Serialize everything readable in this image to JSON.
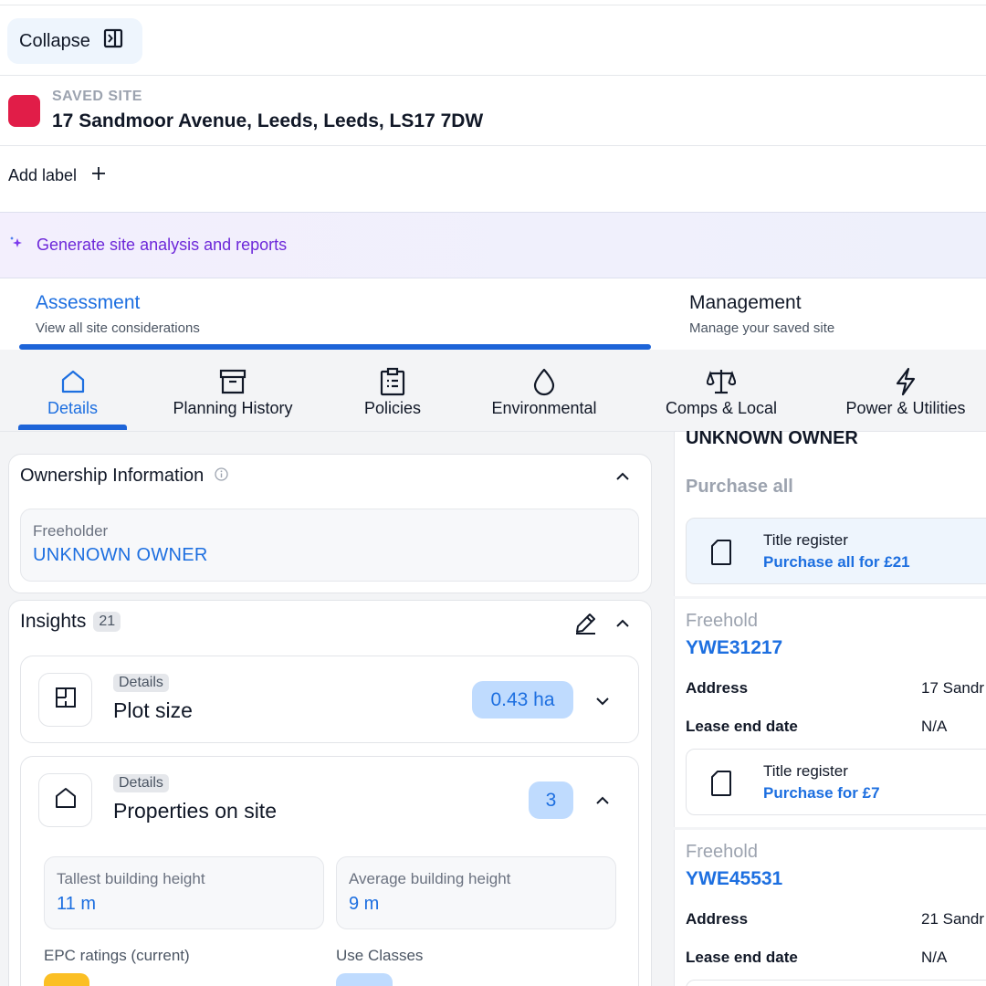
{
  "header": {
    "collapse_label": "Collapse"
  },
  "site": {
    "kicker": "SAVED SITE",
    "address": "17 Sandmoor Avenue, Leeds, Leeds, LS17 7DW",
    "color": "#e11d48"
  },
  "labels": {
    "add_label": "Add label"
  },
  "banner": {
    "text": "Generate site analysis and reports"
  },
  "tabs": [
    {
      "title": "Assessment",
      "subtitle": "View all site considerations",
      "active": true
    },
    {
      "title": "Management",
      "subtitle": "Manage your saved site",
      "active": false
    }
  ],
  "categories": [
    {
      "label": "Details",
      "icon": "home-icon",
      "active": true
    },
    {
      "label": "Planning History",
      "icon": "archive-icon",
      "active": false
    },
    {
      "label": "Policies",
      "icon": "clipboard-icon",
      "active": false
    },
    {
      "label": "Environmental",
      "icon": "droplet-icon",
      "active": false
    },
    {
      "label": "Comps & Local",
      "icon": "scale-icon",
      "active": false
    },
    {
      "label": "Power & Utilities",
      "icon": "bolt-icon",
      "active": false
    }
  ],
  "ownership": {
    "title": "Ownership Information",
    "freeholder_label": "Freeholder",
    "freeholder_value": "UNKNOWN OWNER"
  },
  "insights": {
    "title": "Insights",
    "count": "21",
    "items": [
      {
        "tag": "Details",
        "title": "Plot size",
        "value": "0.43 ha"
      },
      {
        "tag": "Details",
        "title": "Properties on site",
        "value": "3"
      }
    ],
    "metrics": [
      {
        "label": "Tallest building height",
        "value": "11 m"
      },
      {
        "label": "Average building height",
        "value": "9 m"
      }
    ],
    "sub_labels": [
      "EPC ratings (current)",
      "Use Classes"
    ]
  },
  "right": {
    "owner": "UNKNOWN OWNER",
    "purchase_all": "Purchase all",
    "title_register_label": "Title register",
    "purchase_all_price": "Purchase all for £21",
    "titles": [
      {
        "tenure": "Freehold",
        "number": "YWE31217",
        "address_label": "Address",
        "address_value": "17 Sandr",
        "lease_label": "Lease end date",
        "lease_value": "N/A",
        "reg_label": "Title register",
        "reg_price": "Purchase for £7"
      },
      {
        "tenure": "Freehold",
        "number": "YWE45531",
        "address_label": "Address",
        "address_value": "21 Sandr",
        "lease_label": "Lease end date",
        "lease_value": "N/A"
      }
    ]
  },
  "colors": {
    "accent": "#1d6fe0",
    "purple": "#6d28d9",
    "site_swatch": "#e11d48"
  }
}
